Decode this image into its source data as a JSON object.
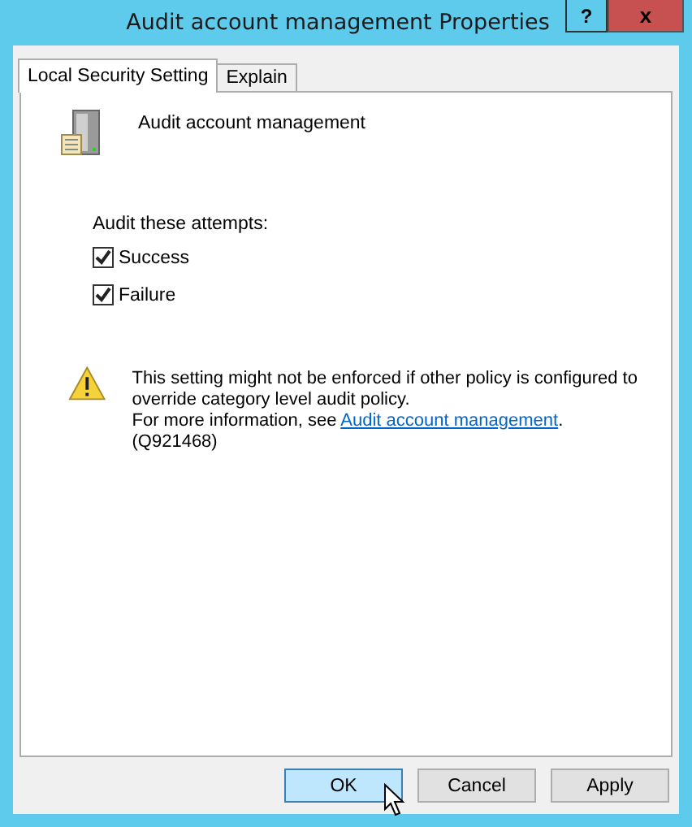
{
  "window": {
    "title": "Audit account management Properties",
    "help": "?",
    "close": "x"
  },
  "tabs": [
    {
      "label": "Local Security Setting",
      "selected": true
    },
    {
      "label": "Explain",
      "selected": false
    }
  ],
  "policy": {
    "name": "Audit account management"
  },
  "attempts": {
    "label": "Audit these attempts:",
    "options": [
      {
        "label": "Success",
        "checked": true
      },
      {
        "label": "Failure",
        "checked": true
      }
    ]
  },
  "warning": {
    "text": "This setting might not be enforced if other policy is configured to override category level audit policy.",
    "more_prefix": "For more information, see ",
    "link": "Audit account management",
    "suffix": ". (Q921468)"
  },
  "buttons": [
    {
      "label": "OK",
      "default": true
    },
    {
      "label": "Cancel",
      "default": false
    },
    {
      "label": "Apply",
      "default": false
    }
  ]
}
